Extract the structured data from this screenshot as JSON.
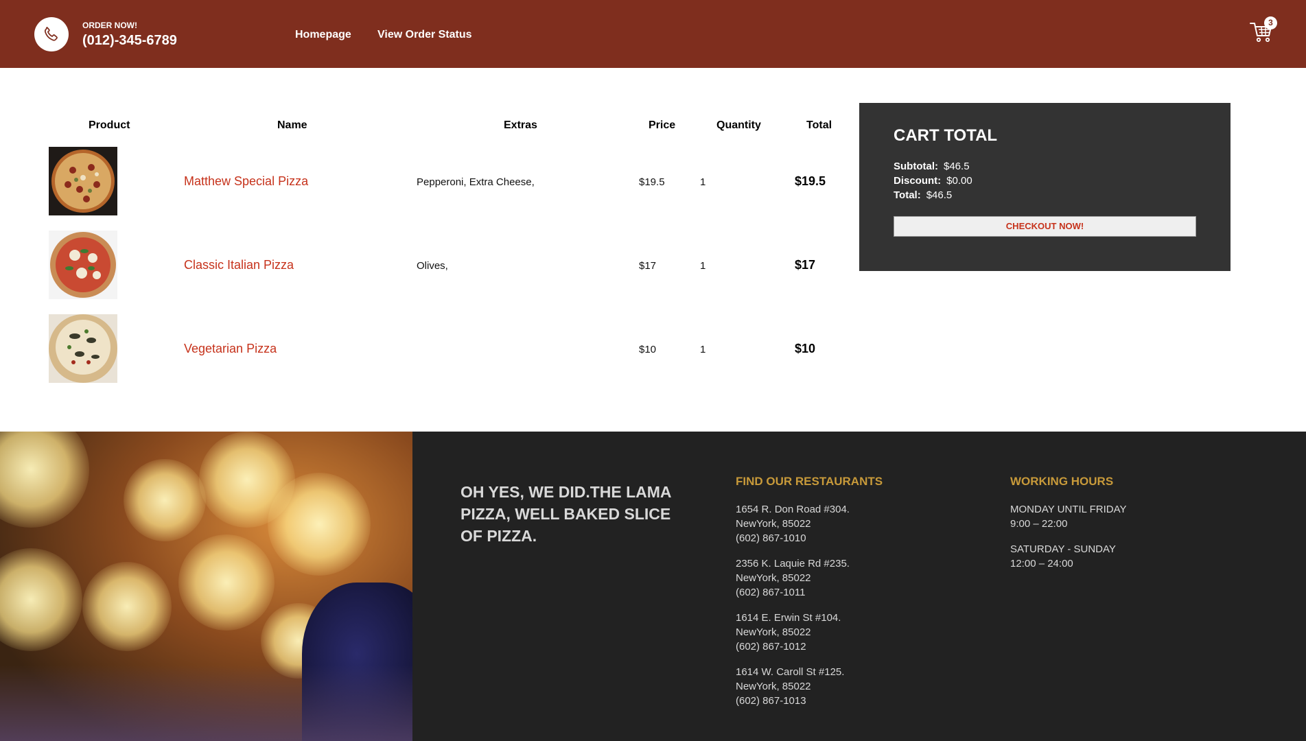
{
  "navbar": {
    "order_label": "ORDER NOW!",
    "phone": "(012)-345-6789",
    "links": [
      "Homepage",
      "View Order Status"
    ],
    "cart_count": "3",
    "bg_color": "#7f2e1e"
  },
  "table": {
    "headers": [
      "Product",
      "Name",
      "Extras",
      "Price",
      "Quantity",
      "Total"
    ],
    "rows": [
      {
        "image": "pizza-image",
        "name": "Matthew Special Pizza",
        "extras": "Pepperoni, Extra Cheese,",
        "price": "$19.5",
        "quantity": "1",
        "total": "$19.5"
      },
      {
        "image": "pizza-image",
        "name": "Classic Italian Pizza",
        "extras": "Olives,",
        "price": "$17",
        "quantity": "1",
        "total": "$17"
      },
      {
        "image": "pizza-image",
        "name": "Vegetarian Pizza",
        "extras": "",
        "price": "$10",
        "quantity": "1",
        "total": "$10"
      }
    ]
  },
  "cart_total": {
    "title": "CART TOTAL",
    "subtotal_label": "Subtotal:",
    "subtotal_value": "$46.5",
    "discount_label": "Discount:",
    "discount_value": "$0.00",
    "total_label": "Total:",
    "total_value": "$46.5",
    "checkout_label": "CHECKOUT NOW!"
  },
  "footer": {
    "motto": "OH YES, WE DID.THE LAMA PIZZA, WELL BAKED SLICE OF PIZZA.",
    "restaurants_heading": "FIND OUR RESTAURANTS",
    "restaurants": [
      {
        "address": "1654 R. Don Road #304.",
        "city": "NewYork, 85022",
        "phone": "(602) 867-1010"
      },
      {
        "address": "2356 K. Laquie Rd #235.",
        "city": "NewYork, 85022",
        "phone": "(602) 867-1011"
      },
      {
        "address": "1614 E. Erwin St #104.",
        "city": "NewYork, 85022",
        "phone": "(602) 867-1012"
      },
      {
        "address": "1614 W. Caroll St #125.",
        "city": "NewYork, 85022",
        "phone": "(602) 867-1013"
      }
    ],
    "hours_heading": "WORKING HOURS",
    "hours": [
      {
        "days": "MONDAY UNTIL FRIDAY",
        "time": "9:00 – 22:00"
      },
      {
        "days": "SATURDAY - SUNDAY",
        "time": "12:00 – 24:00"
      }
    ],
    "heading_color": "#c89a3a"
  }
}
